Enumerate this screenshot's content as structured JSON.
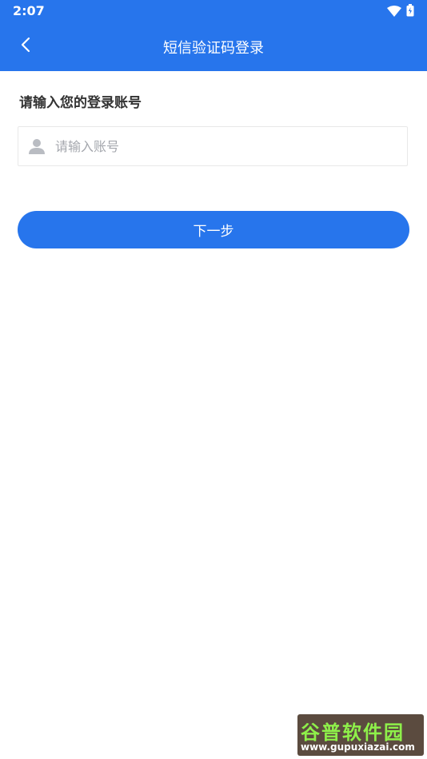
{
  "status_bar": {
    "time": "2:07"
  },
  "header": {
    "title": "短信验证码登录"
  },
  "form": {
    "label": "请输入您的登录账号",
    "account_placeholder": "请输入账号",
    "account_value": ""
  },
  "actions": {
    "next_label": "下一步"
  },
  "watermark": {
    "brand": "谷普软件园",
    "url": "www.gupuxiazai.com"
  },
  "colors": {
    "primary": "#2775ec",
    "placeholder": "#a4a7ad"
  },
  "icons": {
    "back": "chevron-left-icon",
    "user": "user-icon",
    "wifi": "wifi-icon",
    "battery": "battery-icon"
  }
}
